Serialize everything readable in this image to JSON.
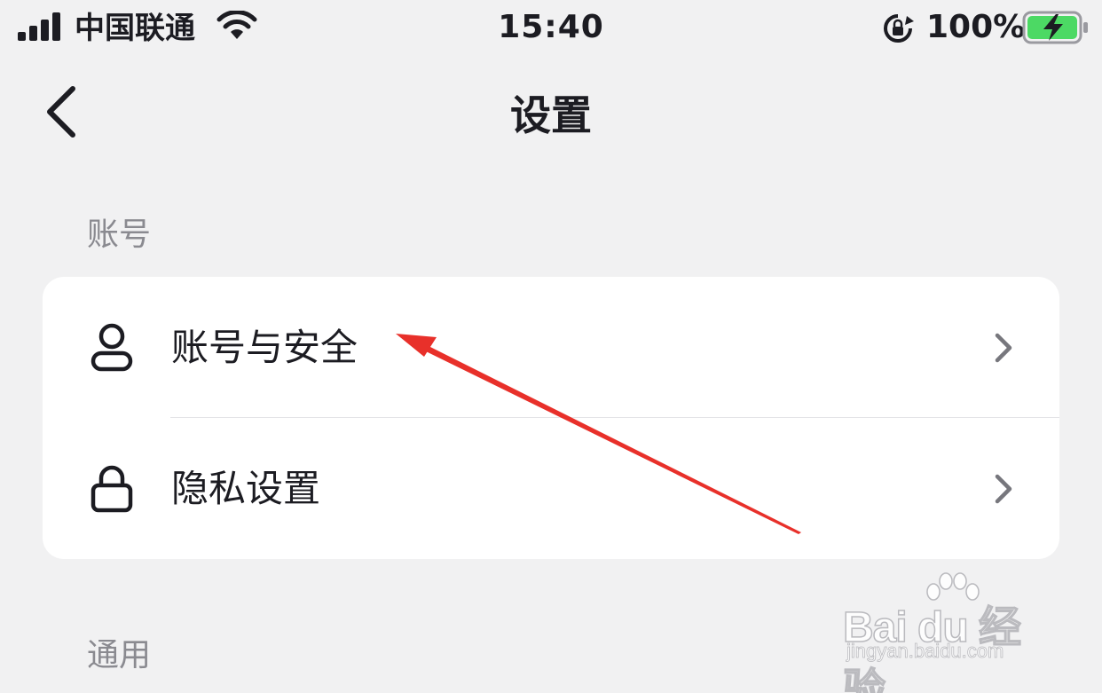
{
  "status_bar": {
    "carrier": "中国联通",
    "time": "15:40",
    "battery_percent": "100%",
    "battery_level": 1.0,
    "icons": [
      "signal-icon",
      "wifi-icon",
      "rotation-lock-icon",
      "battery-charging-icon"
    ],
    "battery_color": "#4cd964"
  },
  "nav": {
    "title": "设置",
    "back_icon": "chevron-left-icon"
  },
  "sections": {
    "account": {
      "header": "账号",
      "items": [
        {
          "label": "账号与安全",
          "icon": "user-icon"
        },
        {
          "label": "隐私设置",
          "icon": "lock-icon"
        }
      ]
    },
    "general": {
      "header": "通用"
    }
  },
  "annotation": {
    "color": "#e8302a",
    "icon": "arrow-annotation"
  },
  "watermark": {
    "brand": "Bai du 经验",
    "url": "jingyan.baidu.com"
  }
}
